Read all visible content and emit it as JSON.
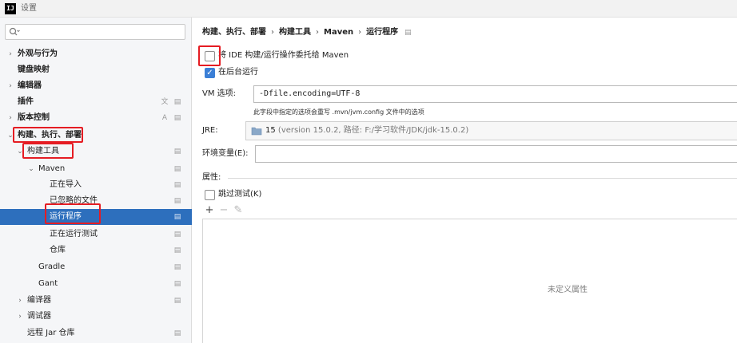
{
  "window": {
    "logo_text": "IJ",
    "title": "设置"
  },
  "search": {
    "value": "",
    "placeholder": ""
  },
  "sidebar": {
    "items": [
      {
        "label": "外观与行为",
        "arrow": "›"
      },
      {
        "label": "键盘映射",
        "arrow": ""
      },
      {
        "label": "编辑器",
        "arrow": "›"
      },
      {
        "label": "插件",
        "arrow": ""
      },
      {
        "label": "版本控制",
        "arrow": "›"
      },
      {
        "label": "构建、执行、部署",
        "arrow": "⌄"
      },
      {
        "label": "构建工具",
        "arrow": "⌄"
      },
      {
        "label": "Maven",
        "arrow": "⌄"
      },
      {
        "label": "正在导入",
        "arrow": ""
      },
      {
        "label": "已忽略的文件",
        "arrow": ""
      },
      {
        "label": "运行程序",
        "arrow": ""
      },
      {
        "label": "正在运行测试",
        "arrow": ""
      },
      {
        "label": "仓库",
        "arrow": ""
      },
      {
        "label": "Gradle",
        "arrow": ""
      },
      {
        "label": "Gant",
        "arrow": ""
      },
      {
        "label": "编译器",
        "arrow": "›"
      },
      {
        "label": "调试器",
        "arrow": "›"
      },
      {
        "label": "远程 Jar 仓库",
        "arrow": ""
      }
    ]
  },
  "breadcrumb": {
    "items": [
      "构建、执行、部署",
      "构建工具",
      "Maven",
      "运行程序"
    ],
    "separator": "›"
  },
  "form": {
    "delegate_label": "将 IDE 构建/运行操作委托给 Maven",
    "delegate_checked": false,
    "background_label": "在后台运行",
    "background_checked": true,
    "vm_label": "VM 选项:",
    "vm_value": "-Dfile.encoding=UTF-8",
    "vm_hint": "此字段中指定的选项会重写 .mvn/jvm.config 文件中的选项",
    "jre_label": "JRE:",
    "jre_version": "15",
    "jre_detail": " (version 15.0.2, 路径: F:/学习软件/JDK/jdk-15.0.2)",
    "env_label": "环境变量(E):",
    "env_value": "",
    "props_title": "属性:",
    "skip_tests_label": "跳过测试(K)",
    "skip_tests_checked": false,
    "props_empty": "未定义属性"
  },
  "colors": {
    "selection": "#2d6fbd",
    "highlight_box": "#e51c23",
    "checkbox_checked": "#3b7fd6"
  }
}
